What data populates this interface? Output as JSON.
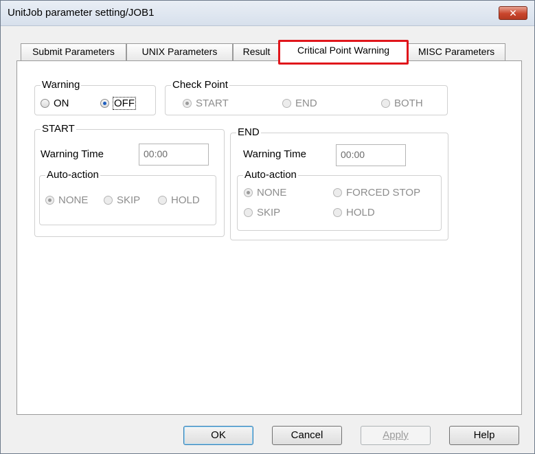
{
  "window": {
    "title": "UnitJob parameter setting/JOB1",
    "close_icon": "✕"
  },
  "tabs": [
    {
      "label": "Submit Parameters"
    },
    {
      "label": "UNIX Parameters"
    },
    {
      "label": "Result"
    },
    {
      "label": "Critical Point Warning",
      "active": true
    },
    {
      "label": "MISC Parameters"
    }
  ],
  "warning": {
    "label": "Warning",
    "on": "ON",
    "off": "OFF",
    "selected": "OFF"
  },
  "check_point": {
    "label": "Check Point",
    "start": "START",
    "end": "END",
    "both": "BOTH",
    "selected": "START"
  },
  "start_group": {
    "label": "START",
    "warning_time_label": "Warning Time",
    "warning_time_value": "00:00",
    "auto_action": {
      "label": "Auto-action",
      "none": "NONE",
      "skip": "SKIP",
      "hold": "HOLD",
      "selected": "NONE"
    }
  },
  "end_group": {
    "label": "END",
    "warning_time_label": "Warning Time",
    "warning_time_value": "00:00",
    "auto_action": {
      "label": "Auto-action",
      "none": "NONE",
      "forced_stop": "FORCED STOP",
      "skip": "SKIP",
      "hold": "HOLD",
      "selected": "NONE"
    }
  },
  "buttons": {
    "ok": "OK",
    "cancel": "Cancel",
    "apply": "Apply",
    "help": "Help"
  },
  "colors": {
    "tab_highlight": "#e0151b",
    "radio_selected": "#1f5fbf"
  }
}
